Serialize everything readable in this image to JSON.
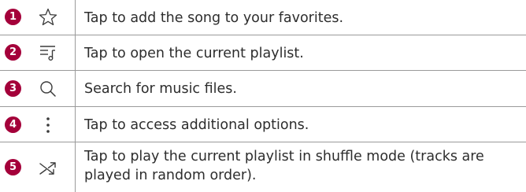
{
  "rows": [
    {
      "number": "1",
      "icon": "star-outline-icon",
      "text": "Tap to add the song to your favorites."
    },
    {
      "number": "2",
      "icon": "playlist-icon",
      "text": "Tap to open the current playlist."
    },
    {
      "number": "3",
      "icon": "search-icon",
      "text": "Search for music files."
    },
    {
      "number": "4",
      "icon": "more-options-icon",
      "text": "Tap to access additional options."
    },
    {
      "number": "5",
      "icon": "shuffle-icon",
      "text": "Tap to play the current playlist in shuffle mode (tracks are played in random order)."
    }
  ],
  "colors": {
    "badge": "#a4003a",
    "rule": "#9a9a9a",
    "text": "#2d2d2d"
  }
}
